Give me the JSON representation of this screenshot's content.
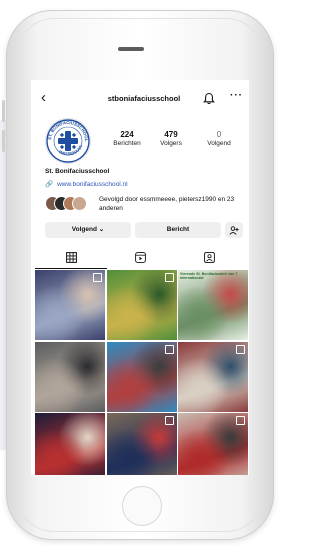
{
  "profile": {
    "username": "stboniafaciusschool",
    "display_name": "St. Bonifaciusschool",
    "website": "www.bonifaciusschool.nl",
    "followed_by": "Gevolgd door essmmeeee, pietersz1990 en 23 anderen",
    "logo_text": "ST. BONIFACIUSSCHOOL WASSENAAR"
  },
  "stats": [
    {
      "value": "224",
      "label": "Berichten"
    },
    {
      "value": "479",
      "label": "Volgers"
    },
    {
      "value": "0",
      "label": "Volgend"
    }
  ],
  "buttons": {
    "follow": "Volgend",
    "message": "Bericht"
  },
  "posts": [
    {
      "caption": "",
      "colors": [
        "#3a3f6a",
        "#9aa6c2",
        "#d8c3b0"
      ]
    },
    {
      "caption": "",
      "colors": [
        "#4f8f3a",
        "#c9b24a",
        "#2a5a2a"
      ]
    },
    {
      "caption": "Vierende St. Bonifaciusdeel van 7 Internationale",
      "colors": [
        "#e9efe6",
        "#6b8f64",
        "#c44a4a"
      ]
    },
    {
      "caption": "",
      "colors": [
        "#5a5c5e",
        "#b0a59a",
        "#2a2a2e"
      ]
    },
    {
      "caption": "",
      "colors": [
        "#2e8cc2",
        "#b04040",
        "#3c3c3c"
      ]
    },
    {
      "caption": "",
      "colors": [
        "#8a3a3a",
        "#d9d0c4",
        "#2f4f6a"
      ]
    },
    {
      "caption": "",
      "colors": [
        "#1c1c38",
        "#b83030",
        "#e0d6c8"
      ]
    },
    {
      "caption": "",
      "colors": [
        "#7a6a58",
        "#1f2f5a",
        "#c63a3a"
      ]
    },
    {
      "caption": "",
      "colors": [
        "#c8bdb4",
        "#b02a2a",
        "#3a3a3a"
      ]
    }
  ]
}
